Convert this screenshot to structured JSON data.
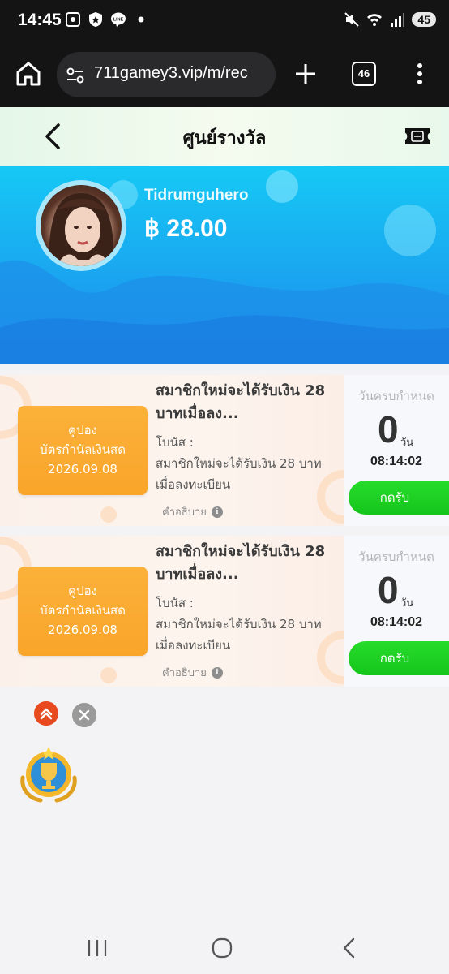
{
  "status_bar": {
    "time": "14:45",
    "battery": "45",
    "icons": [
      "screenshot-icon",
      "shield-icon",
      "line-icon",
      "dot-icon",
      "mute-icon",
      "wifi-icon",
      "signal-icon",
      "battery-icon"
    ]
  },
  "browser": {
    "url": "711gamey3.vip/m/rec",
    "tab_count": "46"
  },
  "header": {
    "title": "ศูนย์รางวัล"
  },
  "profile": {
    "username": "Tidrumguhero",
    "balance": "฿ 28.00"
  },
  "coupons": [
    {
      "coupon_line1": "คูปอง",
      "coupon_line2": "บัตรกำนัลเงินสด",
      "coupon_date": "2026.09.08",
      "title": "สมาชิกใหม่จะได้รับเงิน 28 บาทเมื่อลง...",
      "desc_label": "โบนัส :",
      "desc": "สมาชิกใหม่จะได้รับเงิน 28 บาทเมื่อลงทะเบียน",
      "explain": "คำอธิบาย",
      "deadline_label": "วันครบกำหนด",
      "days": "0",
      "days_unit": "วัน",
      "countdown": "08:14:02",
      "claim": "กดรับ"
    },
    {
      "coupon_line1": "คูปอง",
      "coupon_line2": "บัตรกำนัลเงินสด",
      "coupon_date": "2026.09.08",
      "title": "สมาชิกใหม่จะได้รับเงิน 28 บาทเมื่อลง...",
      "desc_label": "โบนัส :",
      "desc": "สมาชิกใหม่จะได้รับเงิน 28 บาทเมื่อลงทะเบียน",
      "explain": "คำอธิบาย",
      "deadline_label": "วันครบกำหนด",
      "days": "0",
      "days_unit": "วัน",
      "countdown": "08:14:02",
      "claim": "กดรับ"
    }
  ],
  "colors": {
    "claim_green": "#1ccf21",
    "coupon_orange": "#f9a52a",
    "banner_blue": "#1aa6f0"
  }
}
